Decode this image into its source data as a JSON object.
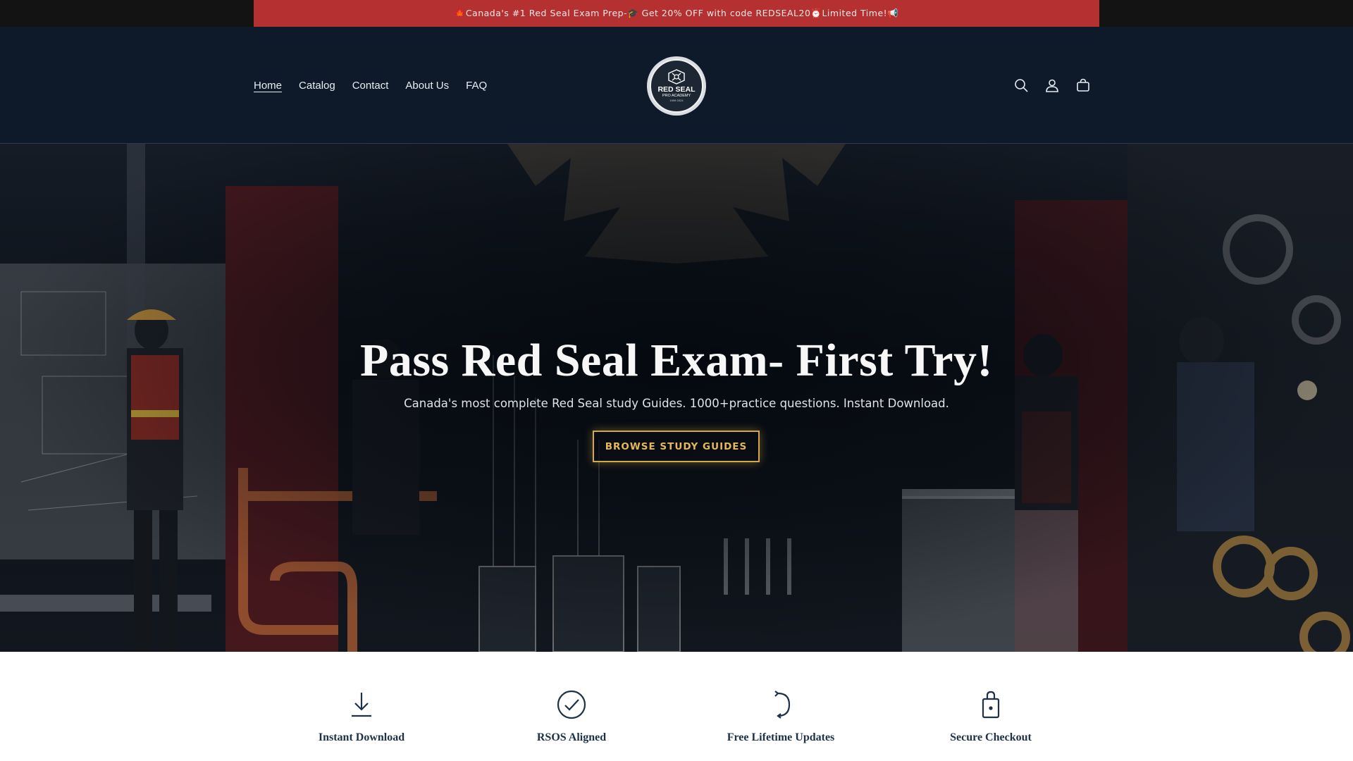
{
  "announcement": {
    "text": "🍁Canada's #1 Red Seal Exam Prep-🎓 Get 20% OFF with code REDSEAL20⏰Limited Time!📢"
  },
  "nav": {
    "items": [
      {
        "label": "Home",
        "active": true
      },
      {
        "label": "Catalog"
      },
      {
        "label": "Contact"
      },
      {
        "label": "About Us"
      },
      {
        "label": "FAQ"
      }
    ]
  },
  "logo": {
    "line1": "RED SEAL",
    "line2": "PRO ACADEMY",
    "line3": "1999·2024"
  },
  "header_icons": [
    "search-icon",
    "account-icon",
    "cart-icon"
  ],
  "hero": {
    "title": "Pass Red Seal Exam- First Try!",
    "subtitle": "Canada's most complete Red Seal study Guides. 1000+practice questions. Instant Download.",
    "cta_label": "BROWSE STUDY GUIDES"
  },
  "features": [
    {
      "label": "Instant Download",
      "icon": "download-icon"
    },
    {
      "label": "RSOS Aligned",
      "icon": "check-circle-icon"
    },
    {
      "label": "Free Lifetime Updates",
      "icon": "refresh-icon"
    },
    {
      "label": "Secure Checkout",
      "icon": "lock-icon"
    }
  ],
  "colors": {
    "announcement_bg": "#b53030",
    "header_bg": "#0e1a2a",
    "accent_gold": "#d4a84a",
    "feature_text": "#1e3148"
  }
}
